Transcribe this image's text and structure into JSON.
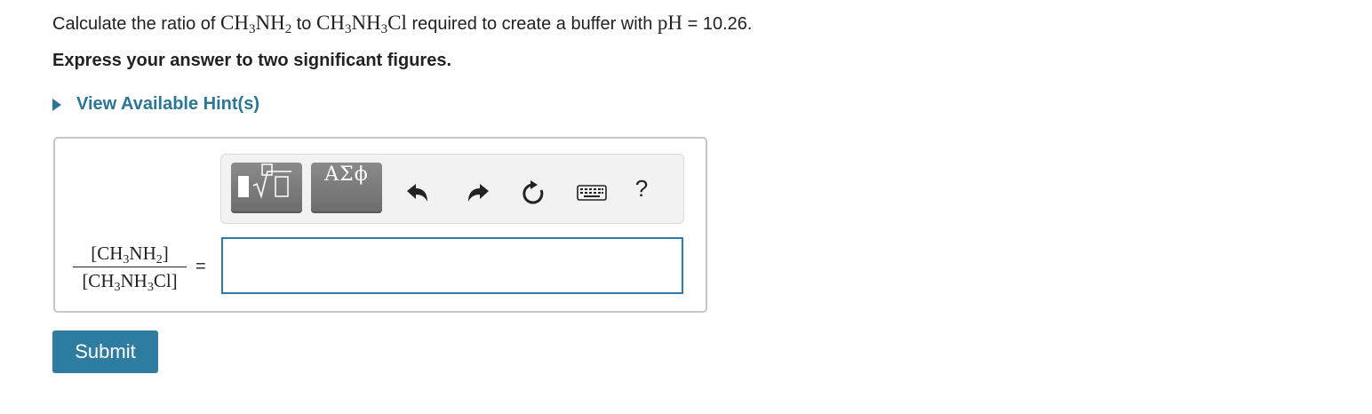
{
  "question": {
    "prefix": "Calculate the ratio of ",
    "base_formula": "CH3NH2",
    "middle": " to ",
    "salt_formula": "CH3NH3Cl",
    "suffix": " required to create a buffer with ",
    "ph_symbol": "pH",
    "equals": " = ",
    "ph_value": "10.26."
  },
  "instruction": "Express your answer to two significant figures.",
  "hint": {
    "label": "View Available Hint(s)",
    "icon": "caret-right-icon"
  },
  "toolbar": {
    "templates_icon": "square-root-template-icon",
    "symbols_label": "ΑΣϕ",
    "undo_icon": "undo-icon",
    "redo_icon": "redo-icon",
    "reset_icon": "reset-icon",
    "keyboard_icon": "keyboard-icon",
    "help_label": "?"
  },
  "answer": {
    "label_numerator": "[CH3NH2]",
    "label_denominator": "[CH3NH3Cl]",
    "equals": "=",
    "value": ""
  },
  "submit_label": "Submit",
  "colors": {
    "link": "#2b7597",
    "input_border": "#2e7ba8",
    "submit_bg": "#2f7ca1",
    "toolbar_button": "#7b7b7b"
  }
}
